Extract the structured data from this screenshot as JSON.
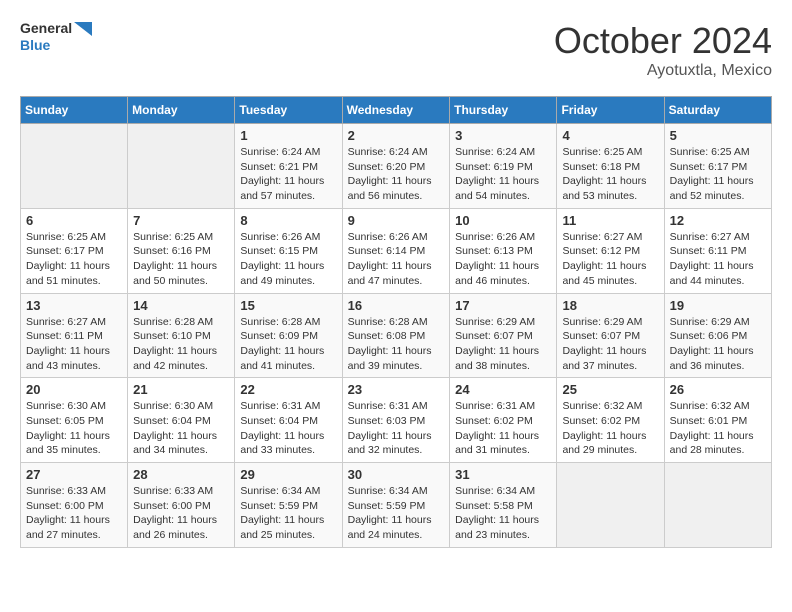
{
  "header": {
    "logo_line1": "General",
    "logo_line2": "Blue",
    "month": "October 2024",
    "location": "Ayotuxtla, Mexico"
  },
  "days_of_week": [
    "Sunday",
    "Monday",
    "Tuesday",
    "Wednesday",
    "Thursday",
    "Friday",
    "Saturday"
  ],
  "weeks": [
    [
      {
        "day": "",
        "empty": true
      },
      {
        "day": "",
        "empty": true
      },
      {
        "day": "1",
        "sunrise": "Sunrise: 6:24 AM",
        "sunset": "Sunset: 6:21 PM",
        "daylight": "Daylight: 11 hours and 57 minutes."
      },
      {
        "day": "2",
        "sunrise": "Sunrise: 6:24 AM",
        "sunset": "Sunset: 6:20 PM",
        "daylight": "Daylight: 11 hours and 56 minutes."
      },
      {
        "day": "3",
        "sunrise": "Sunrise: 6:24 AM",
        "sunset": "Sunset: 6:19 PM",
        "daylight": "Daylight: 11 hours and 54 minutes."
      },
      {
        "day": "4",
        "sunrise": "Sunrise: 6:25 AM",
        "sunset": "Sunset: 6:18 PM",
        "daylight": "Daylight: 11 hours and 53 minutes."
      },
      {
        "day": "5",
        "sunrise": "Sunrise: 6:25 AM",
        "sunset": "Sunset: 6:17 PM",
        "daylight": "Daylight: 11 hours and 52 minutes."
      }
    ],
    [
      {
        "day": "6",
        "sunrise": "Sunrise: 6:25 AM",
        "sunset": "Sunset: 6:17 PM",
        "daylight": "Daylight: 11 hours and 51 minutes."
      },
      {
        "day": "7",
        "sunrise": "Sunrise: 6:25 AM",
        "sunset": "Sunset: 6:16 PM",
        "daylight": "Daylight: 11 hours and 50 minutes."
      },
      {
        "day": "8",
        "sunrise": "Sunrise: 6:26 AM",
        "sunset": "Sunset: 6:15 PM",
        "daylight": "Daylight: 11 hours and 49 minutes."
      },
      {
        "day": "9",
        "sunrise": "Sunrise: 6:26 AM",
        "sunset": "Sunset: 6:14 PM",
        "daylight": "Daylight: 11 hours and 47 minutes."
      },
      {
        "day": "10",
        "sunrise": "Sunrise: 6:26 AM",
        "sunset": "Sunset: 6:13 PM",
        "daylight": "Daylight: 11 hours and 46 minutes."
      },
      {
        "day": "11",
        "sunrise": "Sunrise: 6:27 AM",
        "sunset": "Sunset: 6:12 PM",
        "daylight": "Daylight: 11 hours and 45 minutes."
      },
      {
        "day": "12",
        "sunrise": "Sunrise: 6:27 AM",
        "sunset": "Sunset: 6:11 PM",
        "daylight": "Daylight: 11 hours and 44 minutes."
      }
    ],
    [
      {
        "day": "13",
        "sunrise": "Sunrise: 6:27 AM",
        "sunset": "Sunset: 6:11 PM",
        "daylight": "Daylight: 11 hours and 43 minutes."
      },
      {
        "day": "14",
        "sunrise": "Sunrise: 6:28 AM",
        "sunset": "Sunset: 6:10 PM",
        "daylight": "Daylight: 11 hours and 42 minutes."
      },
      {
        "day": "15",
        "sunrise": "Sunrise: 6:28 AM",
        "sunset": "Sunset: 6:09 PM",
        "daylight": "Daylight: 11 hours and 41 minutes."
      },
      {
        "day": "16",
        "sunrise": "Sunrise: 6:28 AM",
        "sunset": "Sunset: 6:08 PM",
        "daylight": "Daylight: 11 hours and 39 minutes."
      },
      {
        "day": "17",
        "sunrise": "Sunrise: 6:29 AM",
        "sunset": "Sunset: 6:07 PM",
        "daylight": "Daylight: 11 hours and 38 minutes."
      },
      {
        "day": "18",
        "sunrise": "Sunrise: 6:29 AM",
        "sunset": "Sunset: 6:07 PM",
        "daylight": "Daylight: 11 hours and 37 minutes."
      },
      {
        "day": "19",
        "sunrise": "Sunrise: 6:29 AM",
        "sunset": "Sunset: 6:06 PM",
        "daylight": "Daylight: 11 hours and 36 minutes."
      }
    ],
    [
      {
        "day": "20",
        "sunrise": "Sunrise: 6:30 AM",
        "sunset": "Sunset: 6:05 PM",
        "daylight": "Daylight: 11 hours and 35 minutes."
      },
      {
        "day": "21",
        "sunrise": "Sunrise: 6:30 AM",
        "sunset": "Sunset: 6:04 PM",
        "daylight": "Daylight: 11 hours and 34 minutes."
      },
      {
        "day": "22",
        "sunrise": "Sunrise: 6:31 AM",
        "sunset": "Sunset: 6:04 PM",
        "daylight": "Daylight: 11 hours and 33 minutes."
      },
      {
        "day": "23",
        "sunrise": "Sunrise: 6:31 AM",
        "sunset": "Sunset: 6:03 PM",
        "daylight": "Daylight: 11 hours and 32 minutes."
      },
      {
        "day": "24",
        "sunrise": "Sunrise: 6:31 AM",
        "sunset": "Sunset: 6:02 PM",
        "daylight": "Daylight: 11 hours and 31 minutes."
      },
      {
        "day": "25",
        "sunrise": "Sunrise: 6:32 AM",
        "sunset": "Sunset: 6:02 PM",
        "daylight": "Daylight: 11 hours and 29 minutes."
      },
      {
        "day": "26",
        "sunrise": "Sunrise: 6:32 AM",
        "sunset": "Sunset: 6:01 PM",
        "daylight": "Daylight: 11 hours and 28 minutes."
      }
    ],
    [
      {
        "day": "27",
        "sunrise": "Sunrise: 6:33 AM",
        "sunset": "Sunset: 6:00 PM",
        "daylight": "Daylight: 11 hours and 27 minutes."
      },
      {
        "day": "28",
        "sunrise": "Sunrise: 6:33 AM",
        "sunset": "Sunset: 6:00 PM",
        "daylight": "Daylight: 11 hours and 26 minutes."
      },
      {
        "day": "29",
        "sunrise": "Sunrise: 6:34 AM",
        "sunset": "Sunset: 5:59 PM",
        "daylight": "Daylight: 11 hours and 25 minutes."
      },
      {
        "day": "30",
        "sunrise": "Sunrise: 6:34 AM",
        "sunset": "Sunset: 5:59 PM",
        "daylight": "Daylight: 11 hours and 24 minutes."
      },
      {
        "day": "31",
        "sunrise": "Sunrise: 6:34 AM",
        "sunset": "Sunset: 5:58 PM",
        "daylight": "Daylight: 11 hours and 23 minutes."
      },
      {
        "day": "",
        "empty": true
      },
      {
        "day": "",
        "empty": true
      }
    ]
  ]
}
